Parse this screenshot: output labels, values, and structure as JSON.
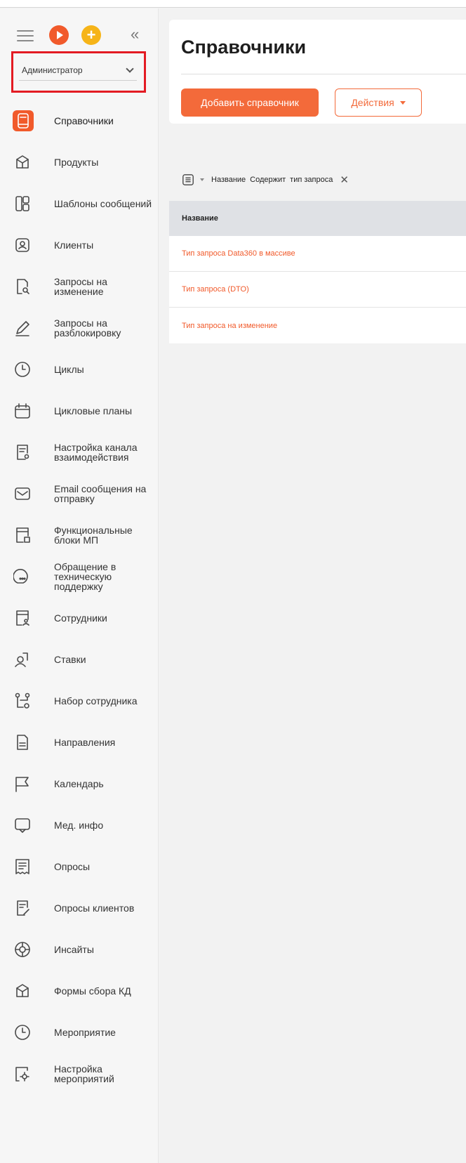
{
  "sidebar": {
    "role": "Администратор",
    "items": [
      {
        "label": "Справочники",
        "icon": "book-icon",
        "active": true
      },
      {
        "label": "Продукты",
        "icon": "box-icon"
      },
      {
        "label": "Шаблоны сообщений",
        "icon": "layout-icon"
      },
      {
        "label": "Клиенты",
        "icon": "person-icon"
      },
      {
        "label": "Запросы на изменение",
        "icon": "document-search-icon"
      },
      {
        "label": "Запросы на разблокировку",
        "icon": "pen-icon"
      },
      {
        "label": "Циклы",
        "icon": "clock-icon"
      },
      {
        "label": "Цикловые планы",
        "icon": "calendar-icon"
      },
      {
        "label": "Настройка канала взаимодействия",
        "icon": "document-gear-icon"
      },
      {
        "label": "Email сообщения на отправку",
        "icon": "envelope-icon"
      },
      {
        "label": "Функциональные блоки МП",
        "icon": "window-blocks-icon"
      },
      {
        "label": "Обращение в техническую поддержку",
        "icon": "chat-bubble-icon"
      },
      {
        "label": "Сотрудники",
        "icon": "id-card-icon"
      },
      {
        "label": "Ставки",
        "icon": "person-document-icon"
      },
      {
        "label": "Набор сотрудника",
        "icon": "org-gear-icon"
      },
      {
        "label": "Направления",
        "icon": "file-icon"
      },
      {
        "label": "Календарь",
        "icon": "flag-icon"
      },
      {
        "label": "Мед. инфо",
        "icon": "message-icon"
      },
      {
        "label": "Опросы",
        "icon": "list-icon"
      },
      {
        "label": "Опросы клиентов",
        "icon": "document-pen-icon"
      },
      {
        "label": "Инсайты",
        "icon": "target-icon"
      },
      {
        "label": "Формы сбора КД",
        "icon": "box-icon"
      },
      {
        "label": "Мероприятие",
        "icon": "clock-icon"
      },
      {
        "label": "Настройка мероприятий",
        "icon": "settings-icon"
      }
    ]
  },
  "main": {
    "title": "Справочники",
    "add_button": "Добавить справочник",
    "actions_button": "Действия",
    "filter": {
      "field": "Название",
      "operator": "Содержит",
      "value": "тип запроса"
    },
    "table": {
      "header": "Название",
      "rows": [
        "Тип запроса Data360 в массиве",
        "Тип запроса (DTO)",
        "Тип запроса на изменение"
      ]
    }
  },
  "colors": {
    "accent": "#f15a2b",
    "warning": "#f6b418",
    "highlight_border": "#e31b23"
  }
}
